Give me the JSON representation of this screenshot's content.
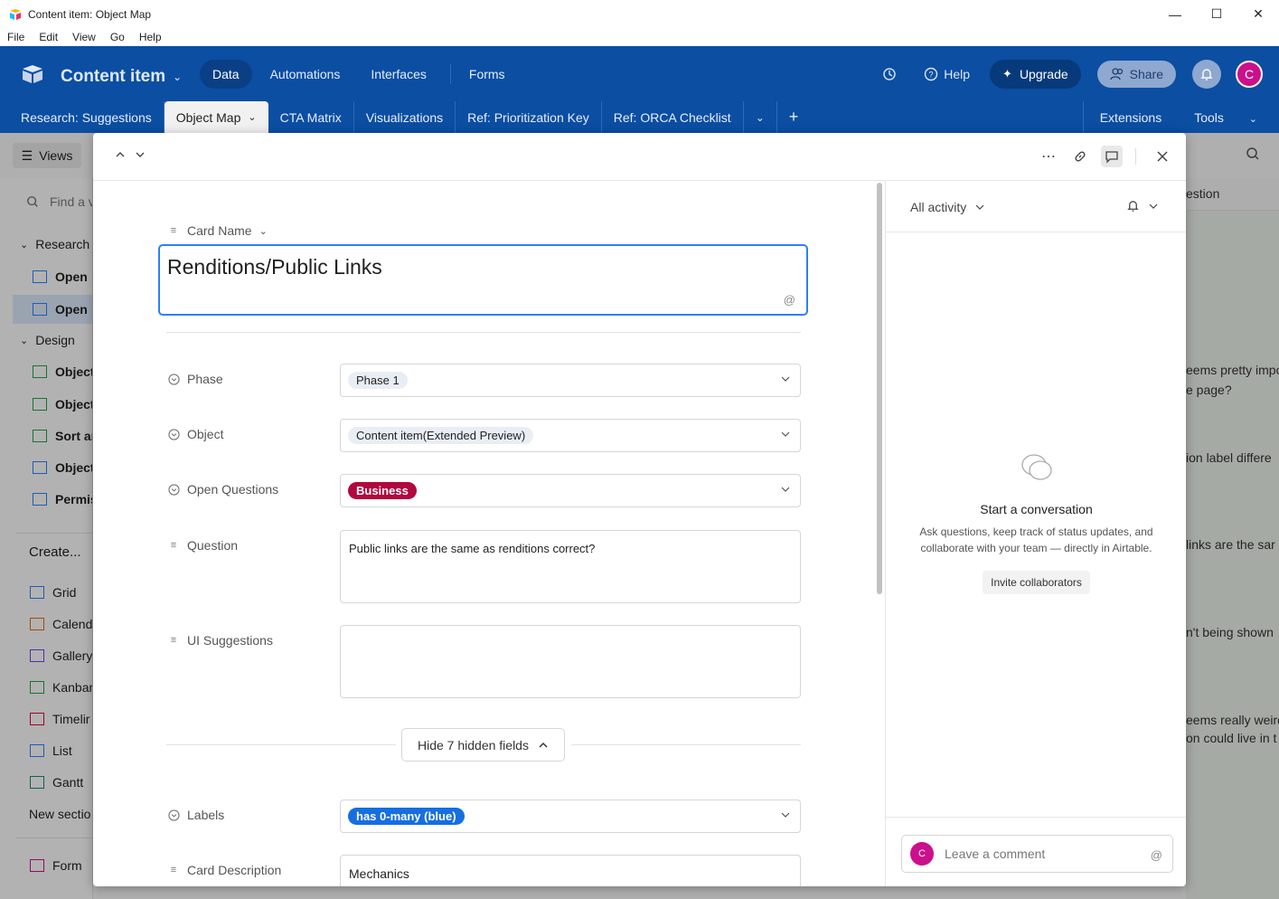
{
  "window": {
    "title": "Content item: Object Map",
    "minimize": "—",
    "maximize": "☐",
    "close": "✕"
  },
  "menu": [
    "File",
    "Edit",
    "View",
    "Go",
    "Help"
  ],
  "app": {
    "base_name": "Content item",
    "nav": [
      "Data",
      "Automations",
      "Interfaces",
      "Forms"
    ],
    "help": "Help",
    "upgrade": "Upgrade",
    "share": "Share",
    "avatar_initial": "C"
  },
  "tabs": [
    "Research: Suggestions",
    "Object Map",
    "CTA Matrix",
    "Visualizations",
    "Ref: Prioritization Key",
    "Ref: ORCA Checklist"
  ],
  "tab_right": [
    "Extensions",
    "Tools"
  ],
  "sidebar": {
    "views_label": "Views",
    "find_placeholder": "Find a v",
    "sections": [
      {
        "label": "Research"
      },
      {
        "label": "Design"
      }
    ],
    "items": [
      "Open",
      "Open",
      "Object",
      "Object",
      "Sort ar",
      "Object",
      "Permis"
    ],
    "create_label": "Create...",
    "create_items": [
      "Grid",
      "Calend",
      "Gallery",
      "Kanbar",
      "Timelir",
      "List",
      "Gantt"
    ],
    "new_section": "New sectio",
    "form": "Form"
  },
  "background_right": [
    "estion",
    "eems pretty impo",
    "e page?",
    "ion label differe",
    "links are the sar",
    "n't being shown",
    "eems really weird",
    "on could live in t"
  ],
  "record": {
    "card_name_label": "Card Name",
    "card_name": "Renditions/Public Links",
    "at_symbol": "@",
    "fields": {
      "phase": {
        "label": "Phase",
        "value": "Phase 1"
      },
      "object": {
        "label": "Object",
        "value": "Content item(Extended Preview)"
      },
      "open_questions": {
        "label": "Open Questions",
        "value": "Business"
      },
      "question": {
        "label": "Question",
        "value": "Public links are the same as renditions correct?"
      },
      "ui_suggestions": {
        "label": "UI Suggestions",
        "value": ""
      },
      "labels": {
        "label": "Labels",
        "value": "has 0-many (blue)"
      },
      "card_description": {
        "label": "Card Description",
        "value": "Mechanics"
      }
    },
    "hide_hidden_fields": "Hide 7 hidden fields"
  },
  "activity": {
    "filter": "All activity",
    "empty_title": "Start a conversation",
    "empty_desc_1": "Ask questions, keep track of status updates, and",
    "empty_desc_2": "collaborate with your team — directly in Airtable.",
    "invite": "Invite collaborators",
    "comment_placeholder": "Leave a comment",
    "avatar_initial": "C"
  },
  "colors": {
    "header": "#0b4ea2",
    "focus": "#2d7ff9",
    "pill_red": "#b0083f",
    "pill_blue": "#166ee1",
    "avatar": "#cc0f8c"
  }
}
